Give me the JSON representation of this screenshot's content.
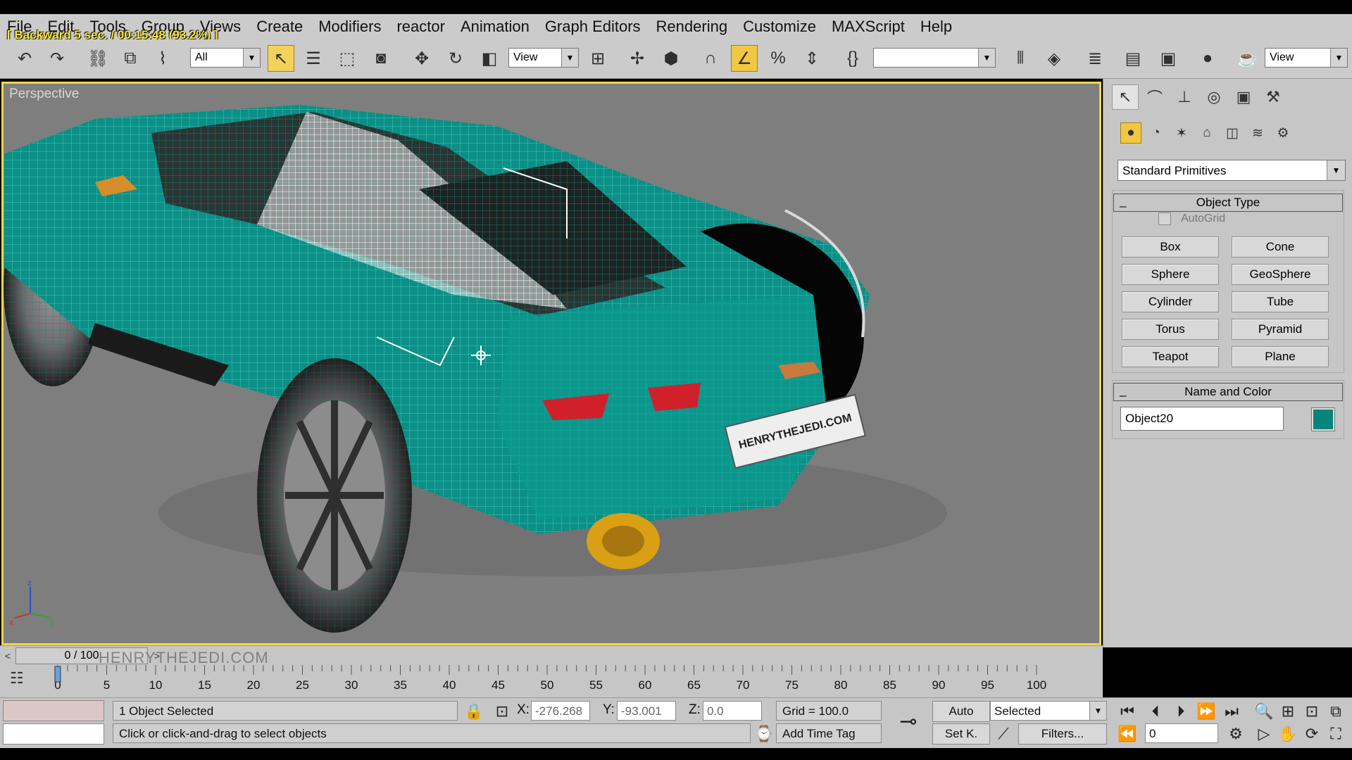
{
  "playback_overlay": "[ Backward 5 sec. / 00:15:48 (93.2%) ]",
  "menu": [
    "File",
    "Edit",
    "Tools",
    "Group",
    "Views",
    "Create",
    "Modifiers",
    "reactor",
    "Animation",
    "Graph Editors",
    "Rendering",
    "Customize",
    "MAXScript",
    "Help"
  ],
  "toolbar": {
    "selection_filter": "All",
    "ref_coord_system": "View",
    "named_selection": "",
    "viewport_dropdown": "View"
  },
  "viewport": {
    "label": "Perspective",
    "plate_text": "HENRYTHEJEDI.COM",
    "axis_labels": {
      "z": "z",
      "x": "x",
      "y": "y"
    },
    "colors": {
      "body": "#0b8f86",
      "wire": "#34c2b4",
      "taillight": "#d0202a",
      "exhaust": "#d9a016",
      "background": "#7e7e7e"
    }
  },
  "command_panel": {
    "category": "Standard Primitives",
    "object_type_title": "Object Type",
    "autogrid_label": "AutoGrid",
    "primitives": [
      "Box",
      "Cone",
      "Sphere",
      "GeoSphere",
      "Cylinder",
      "Tube",
      "Torus",
      "Pyramid",
      "Teapot",
      "Plane"
    ],
    "name_color_title": "Name and Color",
    "object_name": "Object20",
    "object_color": "#08857a"
  },
  "timeline": {
    "frame_display": "0 / 100",
    "watermark": "HENRYTHEJEDI.COM",
    "ticks": [
      "0",
      "5",
      "10",
      "15",
      "20",
      "25",
      "30",
      "35",
      "40",
      "45",
      "50",
      "55",
      "60",
      "65",
      "70",
      "75",
      "80",
      "85",
      "90",
      "95",
      "100"
    ]
  },
  "status": {
    "selection_count": "1 Object Selected",
    "prompt": "Click or click-and-drag to select objects",
    "x_label": "X:",
    "x_value": "-276.268",
    "y_label": "Y:",
    "y_value": "-93.001",
    "z_label": "Z:",
    "z_value": "0.0",
    "grid": "Grid = 100.0",
    "add_time_tag": "Add Time Tag",
    "auto_key": "Auto",
    "set_key": "Set K.",
    "key_mode": "Selected",
    "filters": "Filters...",
    "current_frame": "0"
  }
}
